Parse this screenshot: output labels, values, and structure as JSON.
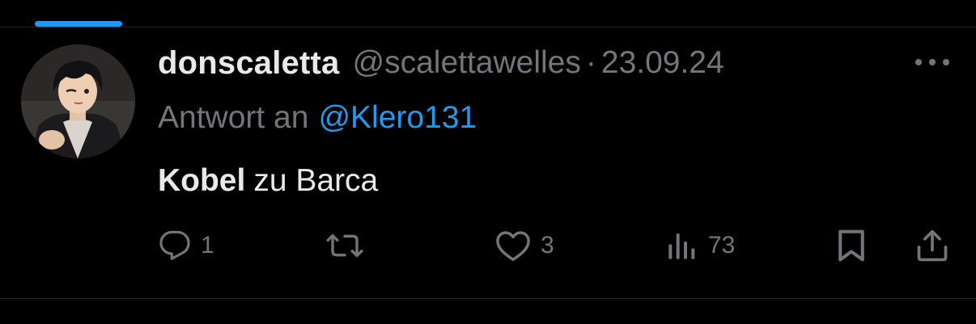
{
  "tweet": {
    "display_name": "donscaletta",
    "handle": "@scalettawelles",
    "separator": "·",
    "date": "23.09.24",
    "reply_prefix": "Antwort an",
    "reply_mention": "@Klero131",
    "text_bold": "Kobel",
    "text_rest": "zu Barca"
  },
  "actions": {
    "replies": "1",
    "retweets": "",
    "likes": "3",
    "views": "73"
  },
  "icons": {
    "more": "more-horizontal-icon",
    "reply": "comment-bubble-icon",
    "retweet": "retweet-icon",
    "like": "heart-icon",
    "views": "bar-chart-icon",
    "bookmark": "bookmark-icon",
    "share": "share-upload-icon"
  },
  "colors": {
    "background": "#000000",
    "primary_text": "#e7e9ea",
    "secondary_text": "#71767b",
    "accent": "#1d9bf0",
    "divider": "#202327"
  }
}
